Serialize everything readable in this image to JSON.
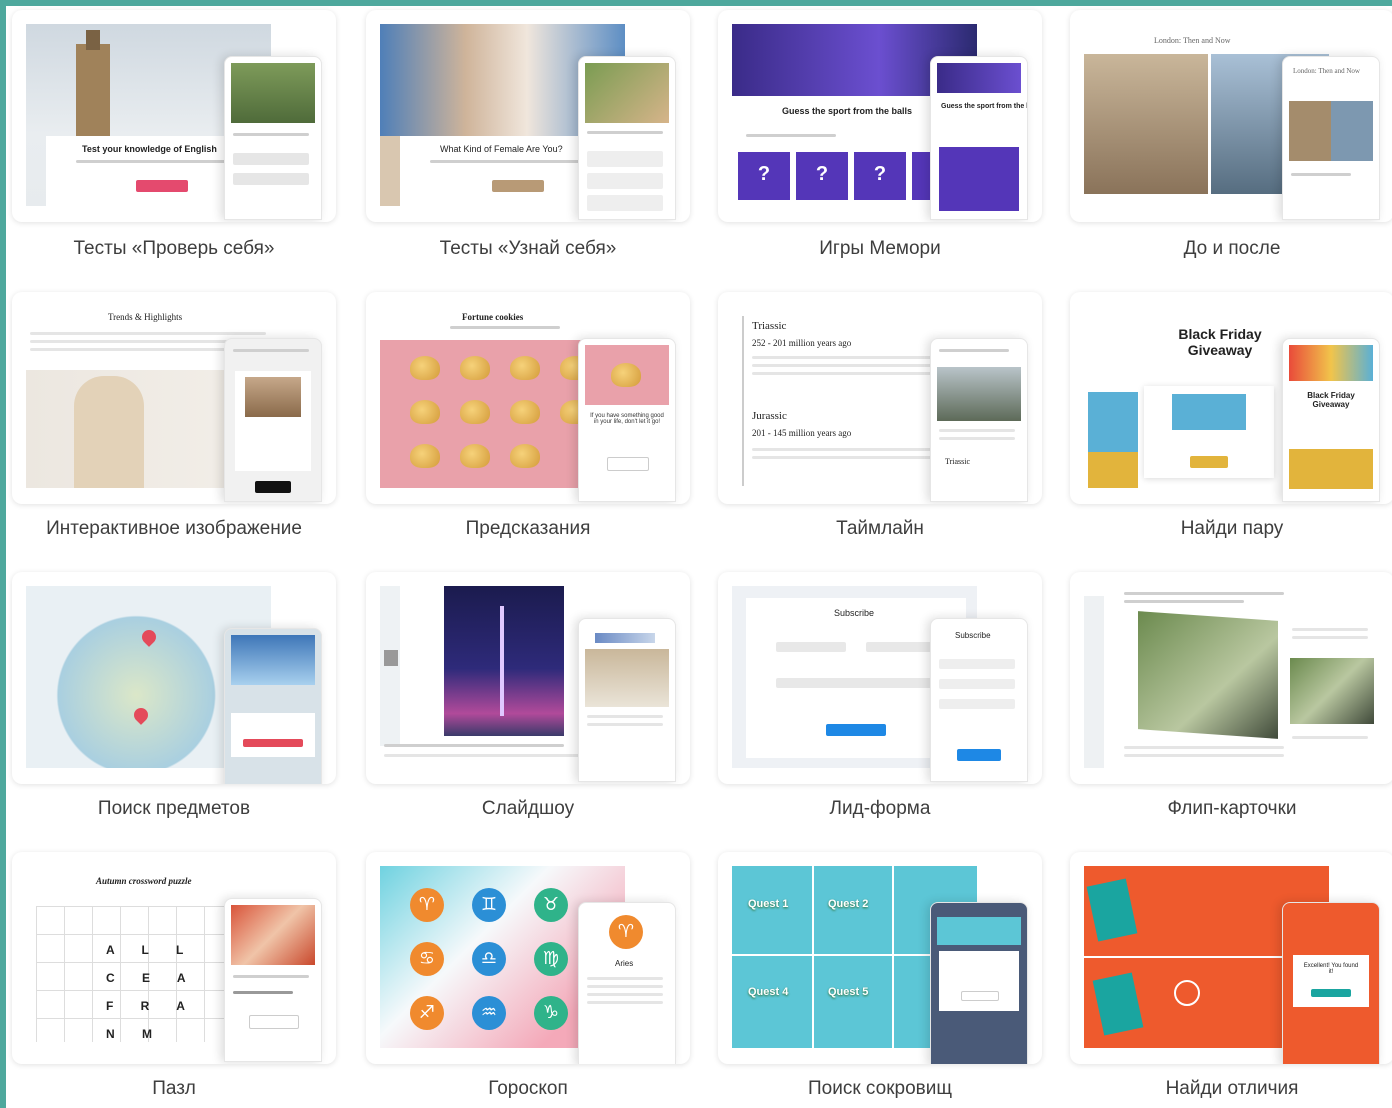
{
  "colors": {
    "frame": "#4ea89d",
    "caption": "#3e3e3e",
    "accent_pink": "#e44a6e",
    "accent_blue": "#1e88e5"
  },
  "templates": [
    {
      "caption": "Тесты «Проверь себя»",
      "title": "Test your knowledge of English"
    },
    {
      "caption": "Тесты «Узнай себя»",
      "title": "What Kind of Female Are You?"
    },
    {
      "caption": "Игры Мемори",
      "title": "Guess the sport from the balls"
    },
    {
      "caption": "До и после",
      "title": "London: Then and Now"
    },
    {
      "caption": "Интерактивное изображение",
      "title": "Trends & Highlights"
    },
    {
      "caption": "Предсказания",
      "title": "Fortune cookies"
    },
    {
      "caption": "Таймлайн",
      "title": "Triassic"
    },
    {
      "caption": "Найди пару",
      "title": "Black Friday Giveaway"
    },
    {
      "caption": "Поиск предметов",
      "title": ""
    },
    {
      "caption": "Слайдшоу",
      "title": ""
    },
    {
      "caption": "Лид-форма",
      "title": "Subscribe"
    },
    {
      "caption": "Флип-карточки",
      "title": ""
    },
    {
      "caption": "Пазл",
      "title": "Autumn crossword puzzle"
    },
    {
      "caption": "Гороскоп",
      "title": "Aries"
    },
    {
      "caption": "Поиск сокровищ",
      "title": "Quest 1"
    },
    {
      "caption": "Найди отличия",
      "title": "Excellent! You found it!"
    }
  ],
  "extra": {
    "jurassic": "Jurassic",
    "triassic_years": "252 - 201 million years ago",
    "jurassic_years": "201 - 145 million years ago",
    "fortune_text": "If you have something good in your life, don't let it go!",
    "quest2": "Quest 2",
    "quest4": "Quest 4",
    "quest5": "Quest 5",
    "memory_q": "?",
    "crossword_letters": "A L L C E A F R A N M",
    "subscribe_mobile": "Subscribe"
  }
}
